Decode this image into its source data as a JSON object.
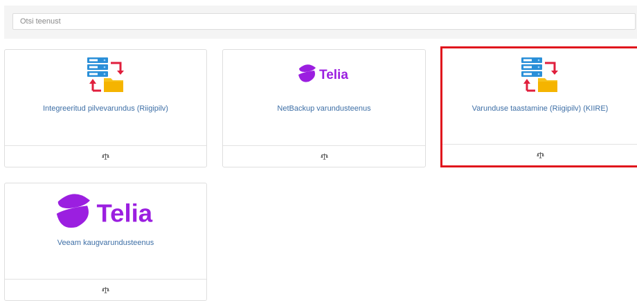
{
  "search": {
    "placeholder": "Otsi teenust"
  },
  "cards": [
    {
      "title": "Integreeritud pilvevarundus (Riigipilv)",
      "icon": "server-folder-backup-icon",
      "footer_icon": "scale-icon"
    },
    {
      "title": "NetBackup varundusteenus",
      "icon": "telia-logo",
      "logo_text": "Telia",
      "footer_icon": "scale-icon"
    },
    {
      "title": "Varunduse taastamine (Riigipilv) (KIIRE)",
      "icon": "server-folder-backup-icon",
      "footer_icon": "scale-icon",
      "selected": true
    },
    {
      "title": "Veeam kaugvarundusteenus",
      "icon": "telia-logo",
      "logo_text": "Telia",
      "footer_icon": "scale-icon"
    }
  ],
  "colors": {
    "title_link": "#3e6fa6",
    "telia_purple": "#9b1fe0",
    "selection_border": "#e0141c",
    "server_blue": "#2a8fd8",
    "arrow_red": "#e01e3c",
    "folder_yellow": "#f7c21a"
  }
}
